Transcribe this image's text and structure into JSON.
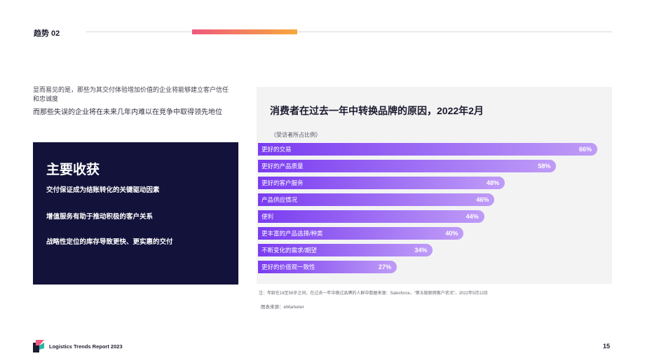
{
  "header": {
    "section_label": "趋势 02"
  },
  "intro": {
    "paragraph_1": "显而易见的是，那些为其交付体验增加价值的企业将能够建立客户信任和忠诚度",
    "paragraph_2": "而那些失误的企业将在未来几年内难以在竞争中取得领先地位"
  },
  "takeaways": {
    "title": "主要收获",
    "items": [
      "交付保证成为结账转化的关键驱动因素",
      "增值服务有助于推动积极的客户关系",
      "战略性定位的库存导致更快、更实惠的交付"
    ]
  },
  "chart_data": {
    "type": "bar",
    "orientation": "horizontal",
    "title": "消费者在过去一年中转换品牌的原因，2022年2月",
    "subtitle": "（受访者所占比例）",
    "categories": [
      "更好的交易",
      "更好的产品质量",
      "更好的客户服务",
      "产品供应情况",
      "便利",
      "更丰富的产品选择/种类",
      "不断变化的需求/期望",
      "更好的价值观一致性"
    ],
    "values": [
      66,
      58,
      48,
      46,
      44,
      40,
      34,
      27
    ],
    "data_labels": [
      "66%",
      "58%",
      "48%",
      "46%",
      "44%",
      "40%",
      "34%",
      "27%"
    ],
    "grid": false,
    "axes_visible": false,
    "legend": "none",
    "note": "注：年龄在18至58岁之间，在过去一年中换过品牌的人群中数据来源：Salesforce，“第五版联网客户状况”，2022年5月13日",
    "source": "图表来源：eMarketer"
  },
  "colors": {
    "accent_gradient_start": "#f0587d",
    "accent_gradient_end": "#f7a83c",
    "bar_gradient_start": "#7a3cf0",
    "bar_gradient_end": "#bf9cf7",
    "takeaways_background": "#12123a",
    "chart_panel_background": "#f3f3f4"
  },
  "footer": {
    "report_title": "Logistics Trends Report 2023",
    "page_number": "15"
  }
}
